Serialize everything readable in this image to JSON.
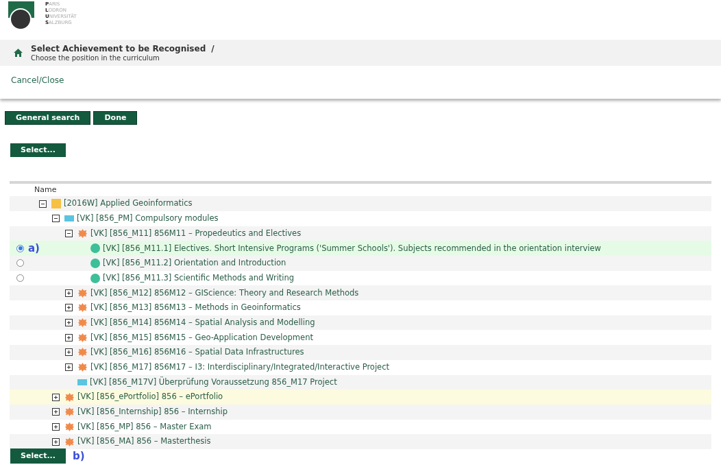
{
  "logo": {
    "lines": [
      {
        "initial": "P",
        "rest": "ARIS"
      },
      {
        "initial": "L",
        "rest": "ODRON"
      },
      {
        "initial": "U",
        "rest": "NIVERSITÄT"
      },
      {
        "initial": "S",
        "rest": "ALZBURG"
      }
    ]
  },
  "header": {
    "title": "Select Achievement to be Recognised",
    "separator": "/",
    "subtitle": "Choose the position in the curriculum"
  },
  "cancel_link": "Cancel/Close",
  "buttons": [
    "General search",
    "Done"
  ],
  "top_select": "Select...",
  "table": {
    "column": "Name",
    "tree": [
      {
        "kind": "folder",
        "label": "[2016W] Applied Geoinformatics",
        "expanded": true,
        "children": [
          {
            "kind": "module",
            "label": "[VK] [856_PM] Compulsory modules",
            "expanded": true,
            "children": [
              {
                "kind": "group",
                "label": "[VK] [856_M11] 856M11 – Propedeutics and Electives",
                "expanded": true,
                "children": [
                  {
                    "kind": "course",
                    "label": "[VK] [856_M11.1] Electives. Short Intensive Programs ('Summer Schools'). Subjects recommended in the orientation interview",
                    "selected": true,
                    "annotation": "a)"
                  },
                  {
                    "kind": "course",
                    "label": "[VK] [856_M11.2] Orientation and Introduction",
                    "selected": false
                  },
                  {
                    "kind": "course",
                    "label": "[VK] [856_M11.3] Scientific Methods and Writing",
                    "selected": false
                  }
                ]
              },
              {
                "kind": "group",
                "label": "[VK] [856_M12] 856M12 – GIScience: Theory and Research Methods",
                "expanded": false
              },
              {
                "kind": "group",
                "label": "[VK] [856_M13] 856M13 – Methods in Geoinformatics",
                "expanded": false
              },
              {
                "kind": "group",
                "label": "[VK] [856_M14] 856M14 – Spatial Analysis and Modelling",
                "expanded": false
              },
              {
                "kind": "group",
                "label": "[VK] [856_M15] 856M15 – Geo-Application Development",
                "expanded": false
              },
              {
                "kind": "group",
                "label": "[VK] [856_M16] 856M16 – Spatial Data Infrastructures",
                "expanded": false
              },
              {
                "kind": "group",
                "label": "[VK] [856_M17] 856M17 – I3: Interdisciplinary/Integrated/Interactive Project",
                "expanded": false
              },
              {
                "kind": "module",
                "label": "[VK] [856_M17V] Überprüfung Voraussetzung 856_M17 Project"
              }
            ]
          },
          {
            "kind": "group",
            "label": "[VK] [856_ePortfolio] 856 – ePortfolio",
            "expanded": false,
            "highlighted": true
          },
          {
            "kind": "group",
            "label": "[VK] [856_Internship] 856 – Internship",
            "expanded": false
          },
          {
            "kind": "group",
            "label": "[VK] [856_MP] 856 – Master Exam",
            "expanded": false
          },
          {
            "kind": "group",
            "label": "[VK] [856_MA] 856 – Masterthesis",
            "expanded": false
          }
        ]
      }
    ]
  },
  "bottom_select": {
    "label": "Select...",
    "annotation": "b)"
  }
}
